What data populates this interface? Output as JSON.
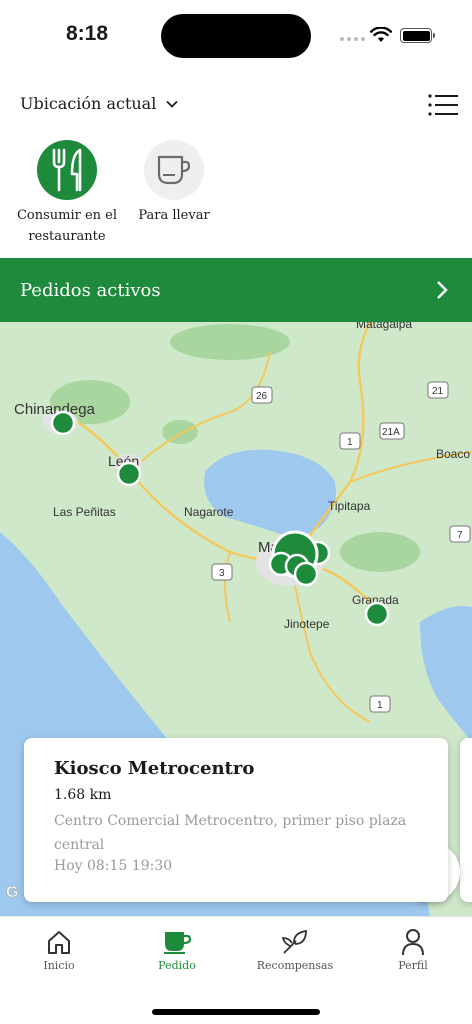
{
  "status_bar": {
    "time": "8:18"
  },
  "header": {
    "location_label": "Ubicación actual"
  },
  "order_types": [
    {
      "label": "Consumir en el restaurante",
      "selected": true,
      "icon": "fork-knife-icon"
    },
    {
      "label": "Para llevar",
      "selected": false,
      "icon": "cup-icon"
    }
  ],
  "active_orders": {
    "label": "Pedidos activos"
  },
  "map": {
    "places": {
      "matagalpa": "Matagalpa",
      "chinandega": "Chinandega",
      "leon": "León",
      "las_penitas": "Las Peñitas",
      "nagarote": "Nagarote",
      "managua": "Managua",
      "tipitapa": "Tipitapa",
      "granada": "Granada",
      "jinotepe": "Jinotepe",
      "boaco": "Boaco"
    },
    "shields": [
      "26",
      "21",
      "1",
      "21A",
      "3",
      "1",
      "7"
    ]
  },
  "store_card": {
    "name": "Kiosco Metrocentro",
    "distance": "1.68 km",
    "address": "Centro Comercial Metrocentro, primer piso plaza central",
    "hours": "Hoy 08:15 19:30"
  },
  "tabs": [
    {
      "label": "Inicio",
      "icon": "home-icon",
      "active": false
    },
    {
      "label": "Pedido",
      "icon": "cup-icon",
      "active": true
    },
    {
      "label": "Recompensas",
      "icon": "leaf-icon",
      "active": false
    },
    {
      "label": "Perfil",
      "icon": "person-icon",
      "active": false
    }
  ],
  "colors": {
    "brand_green": "#1e8a3c",
    "map_water": "#9ec8ee",
    "map_land": "#cfe8c9"
  }
}
